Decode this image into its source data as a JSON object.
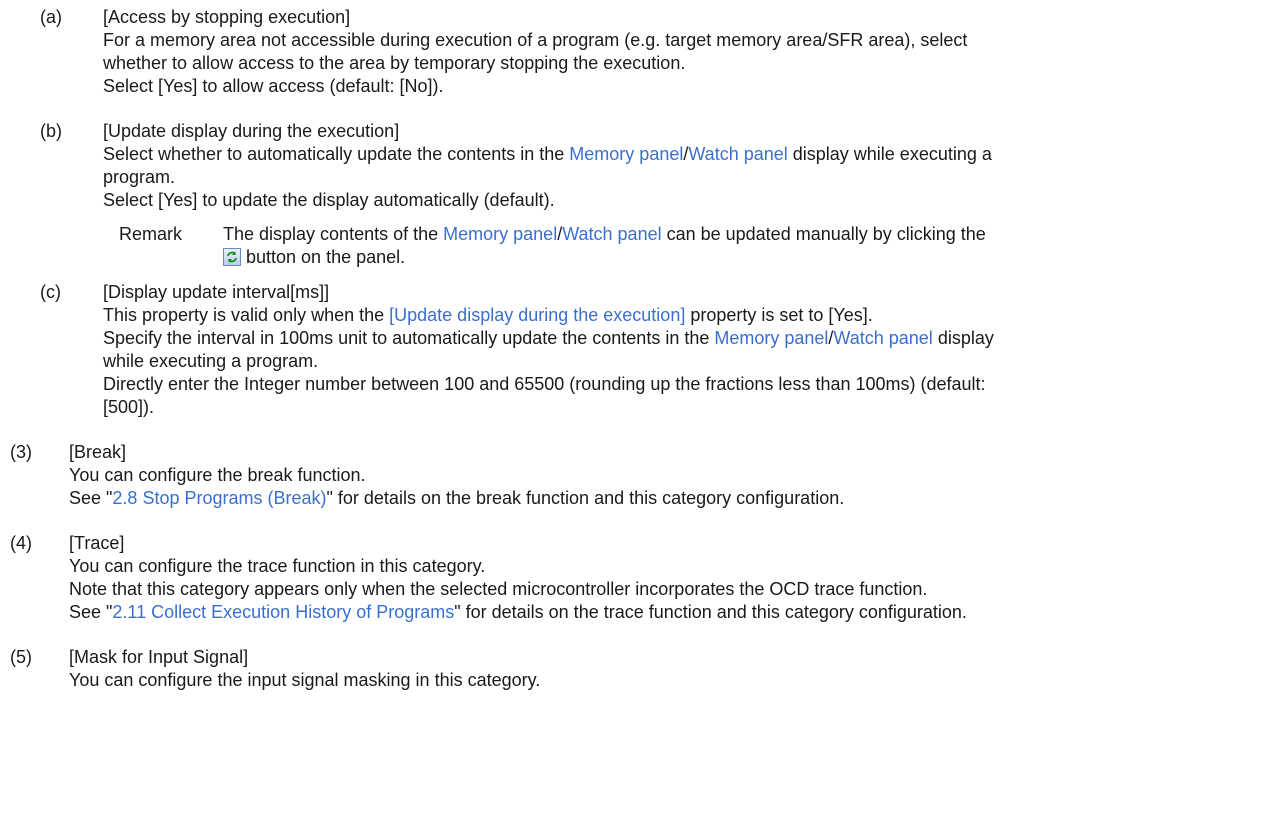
{
  "sub_a": {
    "label": "(a)",
    "title": "[Access by stopping execution]",
    "line1": "For a memory area not accessible during execution of a program (e.g. target memory area/SFR area), select",
    "line2": "whether to allow access to the area by temporary stopping the execution.",
    "line3": "Select [Yes] to allow access (default: [No])."
  },
  "sub_b": {
    "label": "(b)",
    "title": "[Update display during the execution]",
    "line1_pre": "Select whether to automatically update the contents in the ",
    "line1_link1": "Memory panel",
    "line1_sep": "/",
    "line1_link2": "Watch panel",
    "line1_post": " display while executing a",
    "line2": "program.",
    "line3": "Select [Yes] to update the display automatically (default).",
    "remark_label": "Remark",
    "remark_pre": "The display contents of the ",
    "remark_link1": "Memory panel",
    "remark_sep": "/",
    "remark_link2": "Watch panel",
    "remark_post": " can be updated manually by clicking the",
    "remark_line2": " button on the panel."
  },
  "sub_c": {
    "label": "(c)",
    "title": "[Display update interval[ms]]",
    "line1_pre": "This property is valid only when the ",
    "line1_link": "[Update display during the execution]",
    "line1_post": " property is set to [Yes].",
    "line2_pre": "Specify the interval in 100ms unit to automatically update the contents in the ",
    "line2_link1": "Memory panel",
    "line2_sep": "/",
    "line2_link2": "Watch panel",
    "line2_post": " display",
    "line3": "while executing a program.",
    "line4": "Directly enter the Integer number between 100 and 65500 (rounding up the fractions less than 100ms) (default:",
    "line5": "[500])."
  },
  "sec3": {
    "label": "(3)",
    "title": "[Break]",
    "line1": "You can configure the break function.",
    "line2_pre": "See \"",
    "line2_link": "2.8  Stop Programs (Break)",
    "line2_post": "\" for details on the break function and this category configuration."
  },
  "sec4": {
    "label": "(4)",
    "title": "[Trace]",
    "line1": "You can configure the trace function in this category.",
    "line2": "Note that this category appears only when the selected microcontroller incorporates the OCD trace function.",
    "line3_pre": "See \"",
    "line3_link": "2.11  Collect Execution History of Programs",
    "line3_post": "\" for details on the trace function and this category configuration."
  },
  "sec5": {
    "label": "(5)",
    "title": "[Mask for Input Signal]",
    "line1": "You can configure the input signal masking in this category."
  }
}
